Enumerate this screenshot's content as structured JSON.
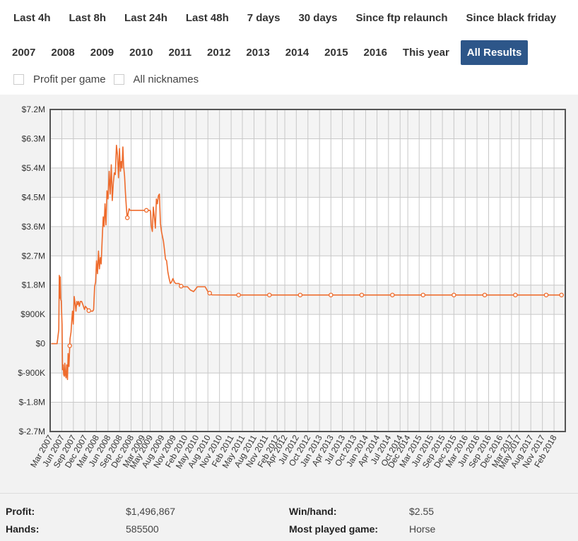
{
  "filters": {
    "range_buttons": [
      "Last 4h",
      "Last 8h",
      "Last 24h",
      "Last 48h",
      "7 days",
      "30 days",
      "Since ftp relaunch",
      "Since black friday"
    ],
    "year_buttons": [
      "2007",
      "2008",
      "2009",
      "2010",
      "2011",
      "2012",
      "2013",
      "2014",
      "2015",
      "2016",
      "This year",
      "All Results"
    ],
    "active": "All Results",
    "checkboxes": [
      {
        "label": "Profit per game",
        "checked": false
      },
      {
        "label": "All nicknames",
        "checked": false
      }
    ]
  },
  "colors": {
    "accent": "#2d5689",
    "line": "#ee6b2c",
    "background": "#f2f2f2"
  },
  "chart_data": {
    "type": "line",
    "title": "",
    "xlabel": "",
    "ylabel": "",
    "ylim": [
      -2700000,
      7200000
    ],
    "y_ticks": [
      {
        "value": -2700000,
        "label": "$-2.7M"
      },
      {
        "value": -1800000,
        "label": "$-1.8M"
      },
      {
        "value": -900000,
        "label": "$-900K"
      },
      {
        "value": 0,
        "label": "$0"
      },
      {
        "value": 900000,
        "label": "$900K"
      },
      {
        "value": 1800000,
        "label": "$1.8M"
      },
      {
        "value": 2700000,
        "label": "$2.7M"
      },
      {
        "value": 3600000,
        "label": "$3.6M"
      },
      {
        "value": 4500000,
        "label": "$4.5M"
      },
      {
        "value": 5400000,
        "label": "$5.4M"
      },
      {
        "value": 6300000,
        "label": "$6.3M"
      },
      {
        "value": 7200000,
        "label": "$7.2M"
      }
    ],
    "xlim": [
      "2007-03",
      "2018-05"
    ],
    "x_tick_labels": [
      "Mar 2007",
      "Jun 2007",
      "Sep 2007",
      "Dec 2007",
      "Mar 2008",
      "Jun 2008",
      "Sep 2008",
      "Dec 2008",
      "Mar 2009",
      "May 2009",
      "Aug 2009",
      "Nov 2009",
      "Feb 2010",
      "May 2010",
      "Aug 2010",
      "Nov 2010",
      "Feb 2011",
      "May 2011",
      "Aug 2011",
      "Nov 2011",
      "Feb 2012",
      "Apr 2012",
      "Jul 2012",
      "Oct 2012",
      "Jan 2013",
      "Apr 2013",
      "Jul 2013",
      "Oct 2013",
      "Jan 2014",
      "Apr 2014",
      "Jul 2014",
      "Oct 2014",
      "Dec 2014",
      "Mar 2015",
      "Jun 2015",
      "Sep 2015",
      "Dec 2015",
      "Mar 2016",
      "Jun 2016",
      "Sep 2016",
      "Dec 2016",
      "Mar 2017",
      "May 2017",
      "Aug 2017",
      "Nov 2017",
      "Feb 2018"
    ],
    "grid": true,
    "series": [
      {
        "x": [
          "2007-03-10",
          "2007-04-25",
          "2007-05-08",
          "2007-05-12",
          "2007-05-16",
          "2007-05-20",
          "2007-05-24",
          "2007-05-28",
          "2007-06-03",
          "2007-06-07",
          "2007-06-12",
          "2007-06-16",
          "2007-06-21",
          "2007-06-25",
          "2007-06-30",
          "2007-07-05",
          "2007-07-10",
          "2007-07-16",
          "2007-07-21",
          "2007-07-28",
          "2007-08-05",
          "2007-08-13",
          "2007-08-20",
          "2007-08-25",
          "2007-08-31",
          "2007-09-07",
          "2007-09-14",
          "2007-09-21",
          "2007-09-28",
          "2007-10-04",
          "2007-10-11",
          "2007-10-18",
          "2007-10-26",
          "2007-11-05",
          "2007-11-15",
          "2007-11-28",
          "2007-12-05",
          "2007-12-15",
          "2007-12-24",
          "2008-01-05",
          "2008-01-18",
          "2008-02-01",
          "2008-02-08",
          "2008-02-16",
          "2008-02-24",
          "2008-03-02",
          "2008-03-10",
          "2008-03-18",
          "2008-03-25",
          "2008-04-01",
          "2008-04-08",
          "2008-04-16",
          "2008-04-24",
          "2008-05-01",
          "2008-05-08",
          "2008-05-16",
          "2008-05-24",
          "2008-06-01",
          "2008-06-10",
          "2008-06-18",
          "2008-06-27",
          "2008-07-05",
          "2008-07-13",
          "2008-07-21",
          "2008-07-29",
          "2008-08-07",
          "2008-08-15",
          "2008-08-23",
          "2008-08-31",
          "2008-09-08",
          "2008-09-14",
          "2008-09-20",
          "2008-09-27",
          "2008-10-03",
          "2008-10-10",
          "2008-10-17",
          "2008-10-24",
          "2008-10-31",
          "2008-11-07",
          "2008-11-15",
          "2008-11-23",
          "2008-12-01",
          "2008-12-08",
          "2008-12-15",
          "2009-01-15",
          "2009-02-15",
          "2009-03-15",
          "2009-04-15",
          "2009-05-01",
          "2009-05-04",
          "2009-05-10",
          "2009-05-18",
          "2009-05-26",
          "2009-06-03",
          "2009-06-11",
          "2009-06-19",
          "2009-06-27",
          "2009-07-05",
          "2009-07-13",
          "2009-07-21",
          "2009-07-29",
          "2009-08-06",
          "2009-08-14",
          "2009-08-22",
          "2009-08-30",
          "2009-09-08",
          "2009-09-18",
          "2009-09-28",
          "2009-10-08",
          "2009-10-18",
          "2009-10-28",
          "2009-11-08",
          "2009-11-18",
          "2009-11-28",
          "2009-12-15",
          "2010-01-05",
          "2010-02-01",
          "2010-02-20",
          "2010-03-15",
          "2010-04-10",
          "2010-05-10",
          "2010-06-01",
          "2010-06-20",
          "2010-07-10",
          "2010-08-01",
          "2010-09-01",
          "2011-01-01",
          "2011-06-01",
          "2012-01-01",
          "2012-06-01",
          "2013-01-01",
          "2013-06-01",
          "2014-01-01",
          "2014-06-01",
          "2015-01-01",
          "2015-06-01",
          "2016-01-01",
          "2016-06-01",
          "2017-01-01",
          "2017-06-01",
          "2018-01-01",
          "2018-04-20"
        ],
        "y": [
          0,
          0,
          430000,
          2100000,
          1400000,
          2050000,
          1350000,
          1320000,
          600000,
          -800000,
          -650000,
          -950000,
          -1000000,
          -600000,
          -950000,
          -1050000,
          -650000,
          -1100000,
          -300000,
          -700000,
          150000,
          350000,
          750000,
          1000000,
          600000,
          1450000,
          1250000,
          1000000,
          1300000,
          1200000,
          1300000,
          1150000,
          1300000,
          1300000,
          1200000,
          1050000,
          1150000,
          1100000,
          1050000,
          1000000,
          1000000,
          1000000,
          1050000,
          1750000,
          1900000,
          2550000,
          2150000,
          2850000,
          2300000,
          2650000,
          2450000,
          3200000,
          3900000,
          3600000,
          4300000,
          3650000,
          4700000,
          4450000,
          5300000,
          4600000,
          5500000,
          4400000,
          4950000,
          5250000,
          5200000,
          6100000,
          5800000,
          5100000,
          6000000,
          5300000,
          5600000,
          5400000,
          6050000,
          5450000,
          5150000,
          4650000,
          4200000,
          3850000,
          4000000,
          4150000,
          4100000,
          4100000,
          4100000,
          4100000,
          4100000,
          4100000,
          4100000,
          4100000,
          4100000,
          4050000,
          3600000,
          3450000,
          4200000,
          3900000,
          3550000,
          4450000,
          4300000,
          4550000,
          4600000,
          3700000,
          3450000,
          3300000,
          3150000,
          2900000,
          2600000,
          2550000,
          2200000,
          2000000,
          1850000,
          1900000,
          2000000,
          1900000,
          1850000,
          1850000,
          1850000,
          1750000,
          1750000,
          1750000,
          1650000,
          1600000,
          1750000,
          1750000,
          1750000,
          1750000,
          1600000,
          1500000,
          1496867,
          1496867,
          1496867,
          1496867,
          1496867,
          1496867,
          1496867,
          1496867,
          1496867,
          1496867,
          1496867,
          1496867,
          1496867,
          1496867,
          1496867,
          1496867
        ],
        "markers_x": [
          "2007-08-03",
          "2008-01-01",
          "2008-11-01",
          "2009-04-01",
          "2010-01-01",
          "2010-08-15",
          "2011-04-01",
          "2011-12-01",
          "2012-08-01",
          "2013-04-01",
          "2013-12-01",
          "2014-08-01",
          "2015-04-01",
          "2015-12-01",
          "2016-08-01",
          "2017-04-01",
          "2017-12-01",
          "2018-04-01"
        ]
      }
    ]
  },
  "stats": {
    "profit_label": "Profit:",
    "profit_value": "$1,496,867",
    "hands_label": "Hands:",
    "hands_value": "585500",
    "winhand_label": "Win/hand:",
    "winhand_value": "$2.55",
    "game_label": "Most played game:",
    "game_value": "Horse"
  }
}
